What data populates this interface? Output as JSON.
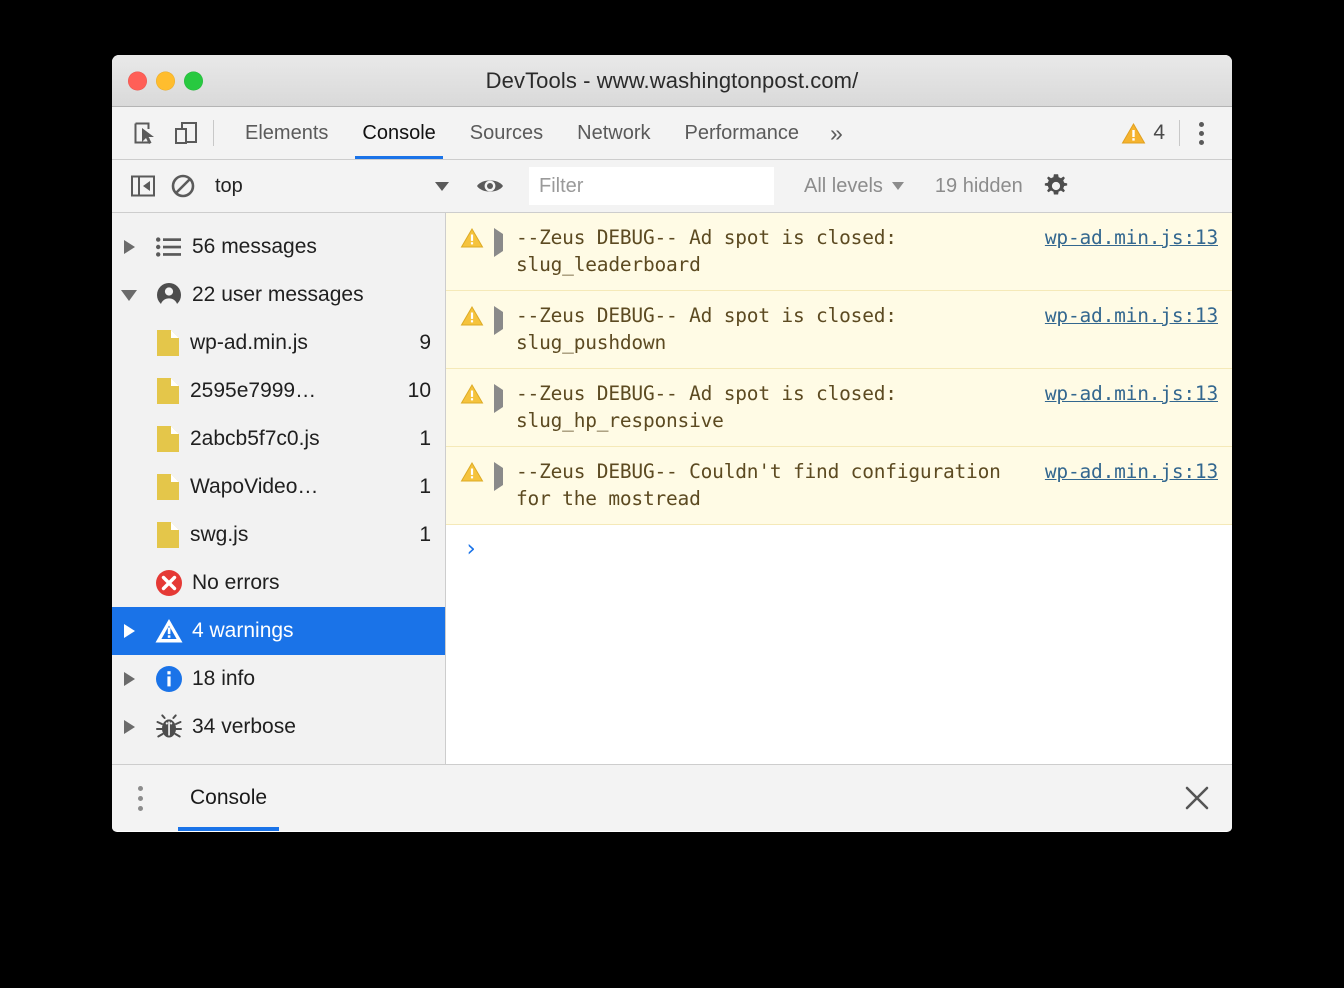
{
  "window": {
    "title": "DevTools - www.washingtonpost.com/",
    "traffic_lights": [
      "close",
      "minimize",
      "maximize"
    ]
  },
  "tab_bar": {
    "left_icons": [
      "inspect-element-icon",
      "device-toolbar-icon"
    ],
    "tabs": [
      {
        "label": "Elements",
        "selected": false
      },
      {
        "label": "Console",
        "selected": true
      },
      {
        "label": "Sources",
        "selected": false
      },
      {
        "label": "Network",
        "selected": false
      },
      {
        "label": "Performance",
        "selected": false
      }
    ],
    "more_tabs_label": "»",
    "warning_count": "4",
    "menu_icon": "kebab-menu-icon"
  },
  "console_toolbar": {
    "sidebar_toggle_icon": "console-sidebar-toggle-icon",
    "clear_icon": "clear-console-icon",
    "context": {
      "value": "top"
    },
    "live_expression_icon": "eye-icon",
    "filter": {
      "placeholder": "Filter",
      "value": ""
    },
    "levels": {
      "value": "All levels"
    },
    "hidden": "19 hidden",
    "settings_icon": "gear-icon"
  },
  "sidebar": {
    "items": [
      {
        "label": "56 messages",
        "count": "",
        "icon": "list-icon",
        "twisty": "closed",
        "depth": 0,
        "selected": false
      },
      {
        "label": "22 user messages",
        "count": "",
        "icon": "user-icon",
        "twisty": "open",
        "depth": 0,
        "selected": false
      },
      {
        "label": "wp-ad.min.js",
        "count": "9",
        "icon": "file-icon",
        "twisty": "none",
        "depth": 1,
        "selected": false
      },
      {
        "label": "2595e7999…",
        "count": "10",
        "icon": "file-icon",
        "twisty": "none",
        "depth": 1,
        "selected": false
      },
      {
        "label": "2abcb5f7c0.js",
        "count": "1",
        "icon": "file-icon",
        "twisty": "none",
        "depth": 1,
        "selected": false
      },
      {
        "label": "WapoVideo…",
        "count": "1",
        "icon": "file-icon",
        "twisty": "none",
        "depth": 1,
        "selected": false
      },
      {
        "label": "swg.js",
        "count": "1",
        "icon": "file-icon",
        "twisty": "none",
        "depth": 1,
        "selected": false
      },
      {
        "label": "No errors",
        "count": "",
        "icon": "error-icon",
        "twisty": "none",
        "depth": 0,
        "selected": false
      },
      {
        "label": "4 warnings",
        "count": "",
        "icon": "warning-icon",
        "twisty": "closed",
        "depth": 0,
        "selected": true
      },
      {
        "label": "18 info",
        "count": "",
        "icon": "info-icon",
        "twisty": "closed",
        "depth": 0,
        "selected": false
      },
      {
        "label": "34 verbose",
        "count": "",
        "icon": "bug-icon",
        "twisty": "closed",
        "depth": 0,
        "selected": false
      }
    ]
  },
  "messages": [
    {
      "level": "warning",
      "text": "--Zeus DEBUG-- Ad spot is closed: slug_leaderboard",
      "source": "wp-ad.min.js:13"
    },
    {
      "level": "warning",
      "text": "--Zeus DEBUG-- Ad spot is closed: slug_pushdown",
      "source": "wp-ad.min.js:13"
    },
    {
      "level": "warning",
      "text": "--Zeus DEBUG-- Ad spot is closed: slug_hp_responsive",
      "source": "wp-ad.min.js:13"
    },
    {
      "level": "warning",
      "text": "--Zeus DEBUG-- Couldn't find configuration for the mostread",
      "source": "wp-ad.min.js:13"
    }
  ],
  "prompt": {
    "chevron": "›",
    "value": ""
  },
  "drawer": {
    "menu_icon": "kebab-menu-icon",
    "tab_label": "Console",
    "close_icon": "close-icon"
  },
  "colors": {
    "accent": "#1a73e8",
    "warning": "#e8a33d",
    "warning_bg": "#fffbe5",
    "error": "#e53935",
    "info": "#1a73e8",
    "file_icon": "#e4c64a",
    "link": "#33678f",
    "message_text": "#5c4a21"
  }
}
